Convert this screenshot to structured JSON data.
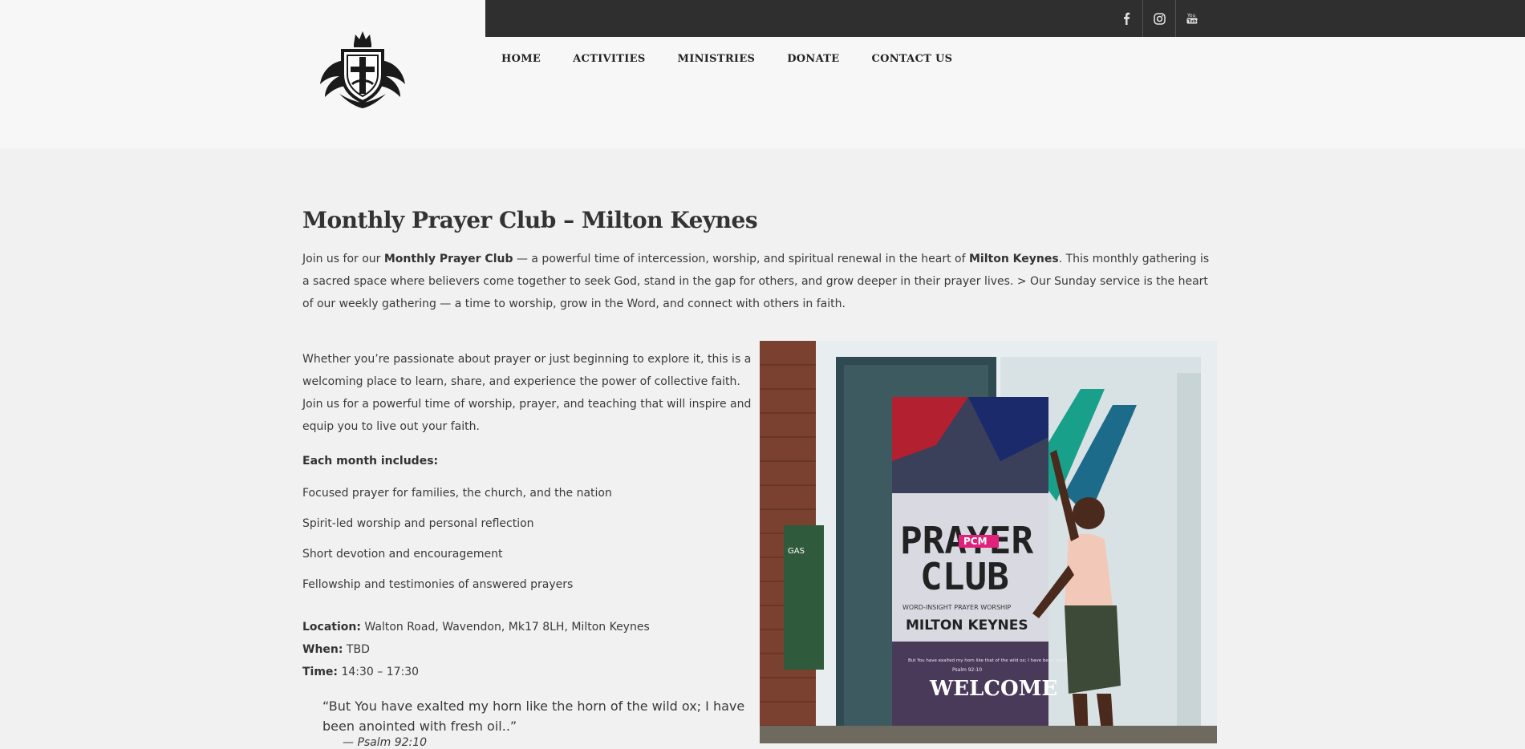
{
  "header": {
    "social": [
      {
        "icon": "facebook-icon",
        "label": "f"
      },
      {
        "icon": "instagram-icon",
        "label": ""
      },
      {
        "icon": "youtube-icon",
        "label": "You Tube"
      }
    ],
    "nav": [
      "HOME",
      "ACTIVITIES",
      "MINISTRIES",
      "DONATE",
      "CONTACT US"
    ]
  },
  "main": {
    "title": "Monthly Prayer Club – Milton Keynes",
    "intro": {
      "p1": "Join us for our ",
      "b1": "Monthly Prayer Club",
      "p2": " — a powerful time of intercession, worship, and spiritual renewal in the heart of ",
      "b2": "Milton Keynes",
      "p3": ". This monthly gathering is a sacred space where believers come together to seek God, stand in the gap for others, and grow deeper in their prayer lives. > Our Sunday service is the heart of our weekly gathering — a time to worship, grow in the Word, and connect with others in faith."
    },
    "body_p1": "Whether you’re passionate about prayer or just beginning to explore it, this is a welcoming place to learn, share, and experience the power of collective faith.",
    "body_p2": "Join us for a powerful time of worship, prayer, and teaching that will inspire and equip you to live out your faith.",
    "includes_heading": "Each month includes:",
    "includes": [
      "Focused prayer for families, the church, and the nation",
      "Spirit-led worship and personal reflection",
      "Short devotion and encouragement",
      "Fellowship and testimonies of answered prayers"
    ],
    "details": {
      "location_label": "Location:",
      "location": " Walton Road, Wavendon, Mk17 8LH, Milton Keynes",
      "when_label": "When:",
      "when": " TBD",
      "time_label": "Time:",
      "time": " 14:30 – 17:30"
    },
    "quote": "“But You have exalted my horn like the horn of the wild ox; I have been anointed with fresh oil..”",
    "quote_ref": "— Psalm 92:10"
  },
  "photo": {
    "banner_title_1": "PRAYER",
    "banner_title_2": "CLUB",
    "banner_tag": "PCM",
    "banner_sub": "WORD-INSIGHT  PRAYER  WORSHIP",
    "banner_city": "MILTON KEYNES",
    "banner_welcome": "WELCOME",
    "banner_quote": "But You have exalted my horn like that of the wild ox; I have been anointed with fresh oil.",
    "banner_ref": "Psalm 92:10",
    "gas_sign": "GAS"
  },
  "colors": {
    "topbar": "#2f2f2f",
    "accent_pink": "#e0227a"
  }
}
